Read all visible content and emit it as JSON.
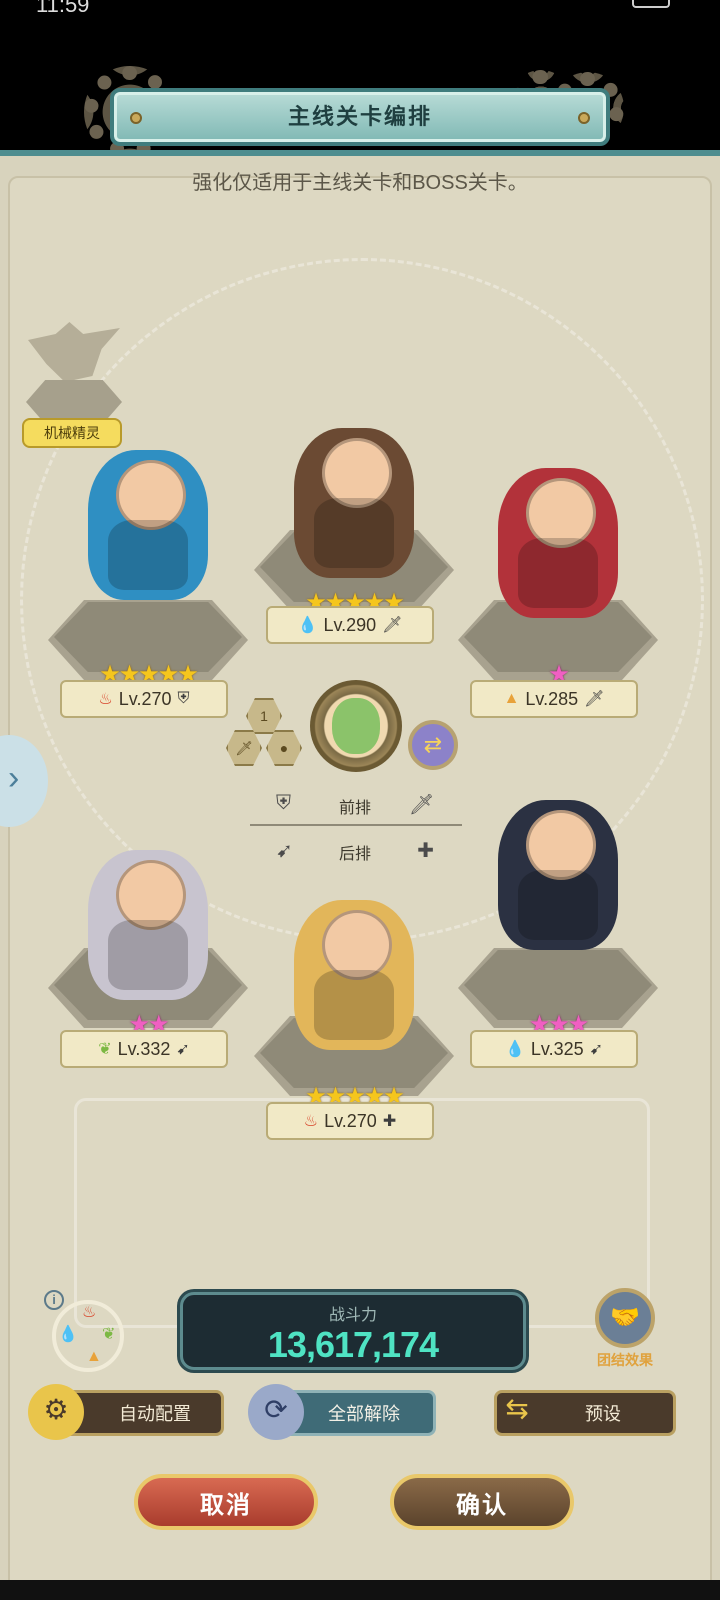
{
  "status": {
    "time": "11:59"
  },
  "title": "主线关卡编排",
  "subtitle": "强化仅适用于主线关卡和BOSS关卡。",
  "pet": {
    "label": "机械精灵"
  },
  "slots": [
    {
      "id": "front-left",
      "stars": "★★★★★",
      "star_color": "gold",
      "element_icon": "♨",
      "element_color": "#d8452b",
      "level": "Lv.270",
      "role_icon": "⛨",
      "hero_color": "#2f8fc2"
    },
    {
      "id": "front-center",
      "stars": "★★★★★",
      "star_color": "gold",
      "element_icon": "💧",
      "element_color": "#3b7fd4",
      "level": "Lv.290",
      "role_icon": "🗡",
      "hero_color": "#6b4a33"
    },
    {
      "id": "front-right",
      "stars": "★",
      "star_color": "pink",
      "element_icon": "▲",
      "element_color": "#e8a23a",
      "level": "Lv.285",
      "role_icon": "🗡",
      "hero_color": "#b2323a"
    },
    {
      "id": "back-left",
      "stars": "★★",
      "star_color": "pink",
      "element_icon": "❦",
      "element_color": "#7cb843",
      "level": "Lv.332",
      "role_icon": "➹",
      "hero_color": "#c8c4cf"
    },
    {
      "id": "back-center",
      "stars": "★★★★★",
      "star_color": "gold",
      "element_icon": "♨",
      "element_color": "#d8452b",
      "level": "Lv.270",
      "role_icon": "✚",
      "hero_color": "#e2b65a"
    },
    {
      "id": "back-right",
      "stars": "★★★",
      "star_color": "pink",
      "element_icon": "💧",
      "element_color": "#3b7fd4",
      "level": "Lv.325",
      "role_icon": "➹",
      "hero_color": "#2b3142"
    }
  ],
  "formation": {
    "slot_number": "1",
    "front_label": "前排",
    "back_label": "后排"
  },
  "power": {
    "label": "战斗力",
    "value": "13,617,174"
  },
  "team_effect": {
    "label": "团结效果"
  },
  "buttons": {
    "auto": "自动配置",
    "remove_all": "全部解除",
    "preset": "预设",
    "cancel": "取消",
    "confirm": "确认"
  },
  "colors": {
    "panel": "#ddd8c2",
    "accent_teal": "#4e8d8f",
    "power_text": "#4fe3c3",
    "team_effect_label": "#e0a23d"
  }
}
